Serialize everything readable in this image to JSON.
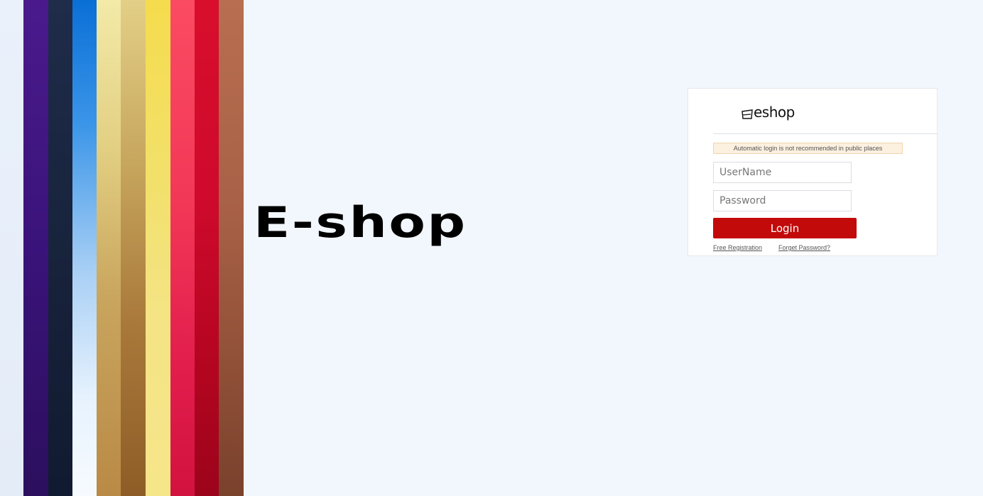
{
  "hero": {
    "title": "E-shop"
  },
  "login": {
    "logo_text": "eshop",
    "notice": "Automatic login is not recommended in public places",
    "username_placeholder": "UserName",
    "password_placeholder": "Password",
    "login_label": "Login",
    "register_link": "Free Registration",
    "forgot_link": "Forget Password?"
  },
  "colors": {
    "background": "#f2f6fd",
    "login_button": "#c30a0a",
    "notice_bg": "#fcf0df",
    "stripes": [
      "#3a137a",
      "#18233c",
      "#3b95e8",
      "#e2cf82",
      "#a9793b",
      "#f2e06a",
      "#f23857",
      "#cf0a2c",
      "#a96247"
    ]
  },
  "icons": {
    "logo": "cart-logo-icon"
  }
}
